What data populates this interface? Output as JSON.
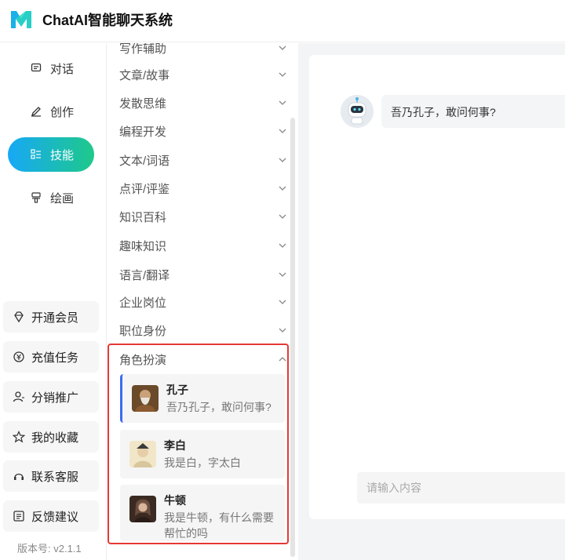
{
  "app": {
    "title": "ChatAI智能聊天系统",
    "brand_color": "#1ab0e8"
  },
  "left_nav": {
    "items": [
      {
        "label": "对话",
        "icon": "message-icon",
        "active": false
      },
      {
        "label": "创作",
        "icon": "pen-icon",
        "active": false
      },
      {
        "label": "技能",
        "icon": "skills-icon",
        "active": true
      },
      {
        "label": "绘画",
        "icon": "brush-icon",
        "active": false
      }
    ],
    "bottom": [
      {
        "label": "开通会员",
        "icon": "diamond-icon"
      },
      {
        "label": "充值任务",
        "icon": "coin-icon"
      },
      {
        "label": "分销推广",
        "icon": "user-icon"
      },
      {
        "label": "我的收藏",
        "icon": "star-icon"
      },
      {
        "label": "联系客服",
        "icon": "headset-icon"
      },
      {
        "label": "反馈建议",
        "icon": "feedback-icon"
      }
    ],
    "version": "版本号: v2.1.1"
  },
  "categories": [
    "写作辅助",
    "文章/故事",
    "发散思维",
    "编程开发",
    "文本/词语",
    "点评/评鉴",
    "知识百科",
    "趣味知识",
    "语言/翻译",
    "企业岗位",
    "职位身份"
  ],
  "role_section": {
    "title": "角色扮演",
    "roles": [
      {
        "name": "孔子",
        "desc": "吾乃孔子，敢问何事?"
      },
      {
        "name": "李白",
        "desc": "我是白，字太白"
      },
      {
        "name": "牛顿",
        "desc": "我是牛顿，有什么需要帮忙的吗"
      }
    ]
  },
  "chat": {
    "bot_message": "吾乃孔子，敢问何事?",
    "input_placeholder": "请输入内容"
  }
}
